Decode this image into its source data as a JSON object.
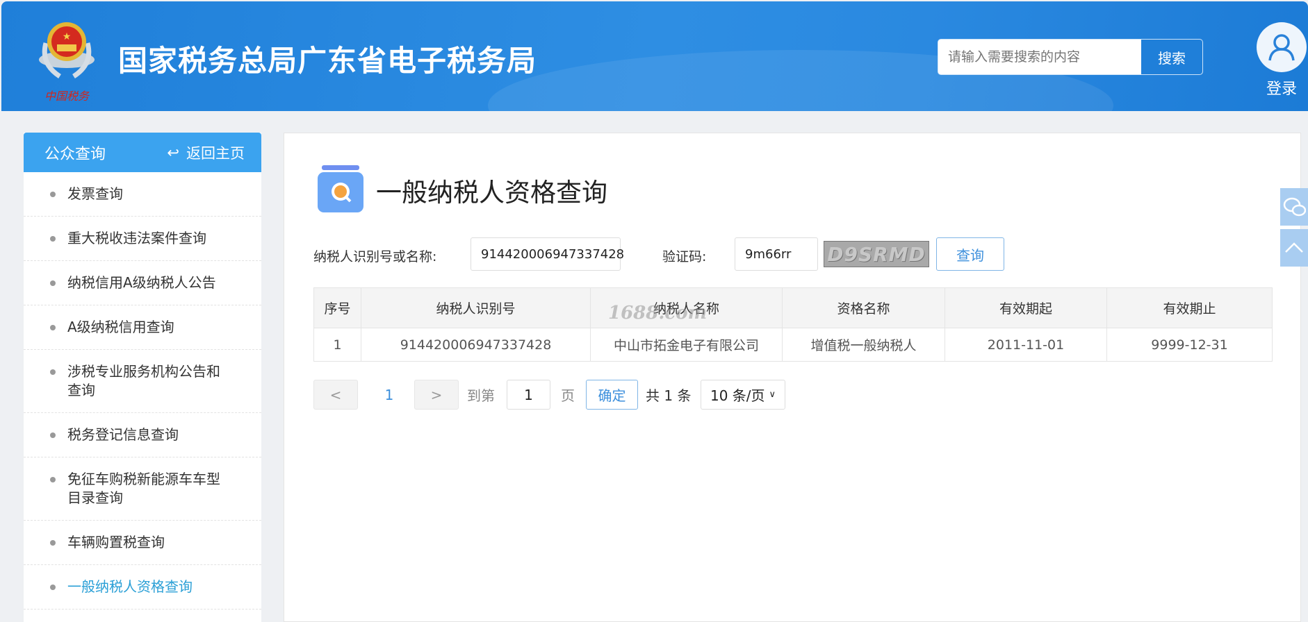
{
  "header": {
    "title": "国家税务总局广东省电子税务局",
    "logo_text": "中国税务",
    "search_placeholder": "请输入需要搜索的内容",
    "search_button": "搜索",
    "login_label": "登录"
  },
  "sidebar": {
    "title": "公众查询",
    "back_label": "返回主页",
    "items": [
      {
        "label": "发票查询"
      },
      {
        "label": "重大税收违法案件查询"
      },
      {
        "label": "纳税信用A级纳税人公告"
      },
      {
        "label": "A级纳税信用查询"
      },
      {
        "label": "涉税专业服务机构公告和查询"
      },
      {
        "label": "税务登记信息查询"
      },
      {
        "label": "免征车购税新能源车车型目录查询"
      },
      {
        "label": "车辆购置税查询"
      },
      {
        "label": "一般纳税人资格查询"
      }
    ]
  },
  "main": {
    "title": "一般纳税人资格查询",
    "form": {
      "id_label": "纳税人识别号或名称:",
      "id_value": "914420006947337428",
      "captcha_label": "验证码:",
      "captcha_value": "9m66rr",
      "captcha_image_text": "D9SRMD",
      "query_button": "查询"
    },
    "table": {
      "headers": [
        "序号",
        "纳税人识别号",
        "纳税人名称",
        "资格名称",
        "有效期起",
        "有效期止"
      ],
      "rows": [
        [
          "1",
          "914420006947337428",
          "中山市拓金电子有限公司",
          "增值税一般纳税人",
          "2011-11-01",
          "9999-12-31"
        ]
      ]
    },
    "watermark": "1688.com",
    "pagination": {
      "prev": "<",
      "current": "1",
      "next": ">",
      "goto_label": "到第",
      "goto_value": "1",
      "page_label": "页",
      "confirm": "确定",
      "total": "共 1 条",
      "page_size": "10 条/页"
    }
  },
  "colors": {
    "header": "#1f7fd9",
    "sidebar_header": "#3ba3ef",
    "active": "#2a9fd6"
  }
}
